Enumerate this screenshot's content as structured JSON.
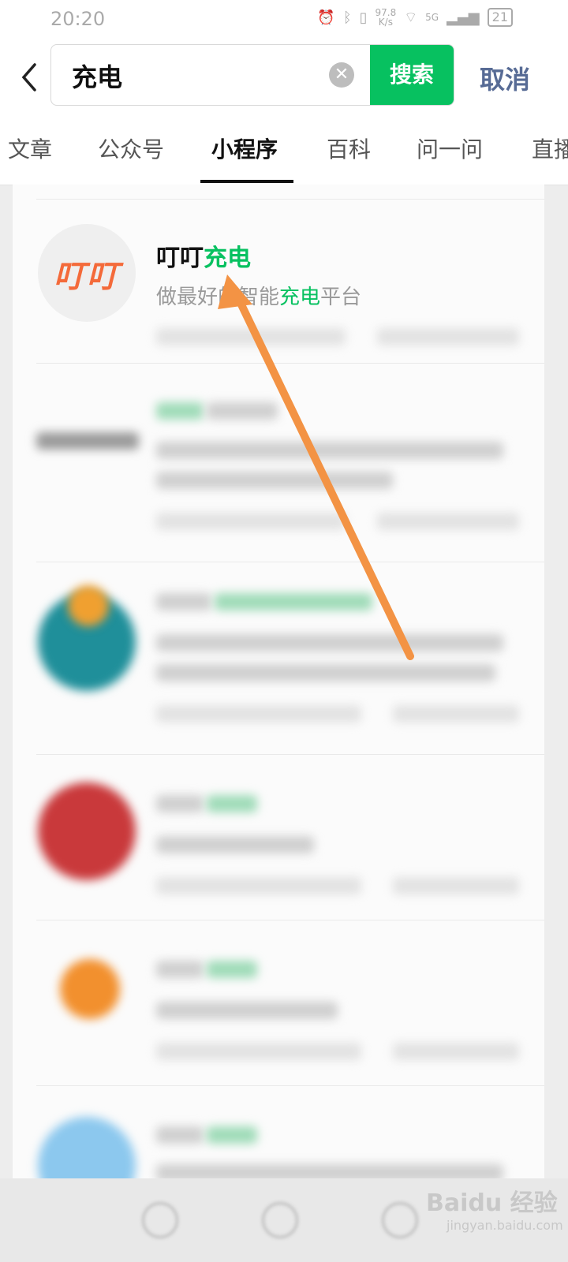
{
  "status_bar": {
    "time": "20:20",
    "speed_value": "97.8",
    "speed_unit": "K/s",
    "network": "5G",
    "battery": "21"
  },
  "search": {
    "query": "充电",
    "button_label": "搜索",
    "cancel_label": "取消"
  },
  "tabs": [
    {
      "label": "文章"
    },
    {
      "label": "公众号"
    },
    {
      "label": "小程序"
    },
    {
      "label": "百科"
    },
    {
      "label": "问一问"
    },
    {
      "label": "直播"
    }
  ],
  "results": {
    "first": {
      "logo_text": "叮叮",
      "title_prefix": "叮叮",
      "title_highlight": "充电",
      "desc_prefix": "做最好的智能",
      "desc_highlight": "充电",
      "desc_suffix": "平台"
    }
  },
  "watermark": {
    "brand": "Baidu 经验",
    "url": "jingyan.baidu.com"
  },
  "colors": {
    "accent": "#07c160",
    "link": "#576b95",
    "arrow": "#f39344"
  }
}
